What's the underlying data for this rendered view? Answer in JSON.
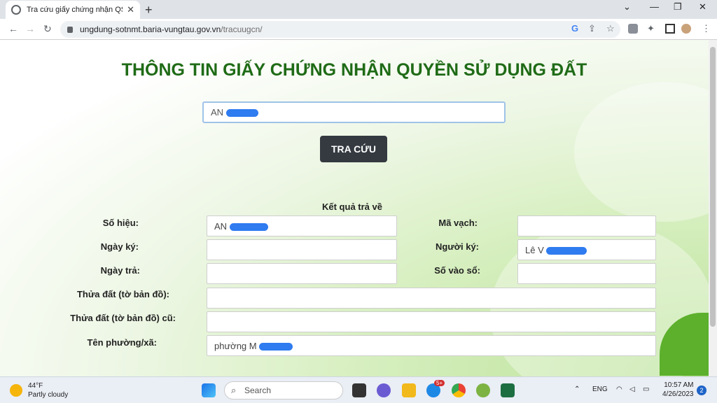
{
  "browser": {
    "tab_title": "Tra cứu giấy chứng nhận QSDĐ",
    "tab_close": "✕",
    "new_tab": "+",
    "url_host": "ungdung-sotnmt.baria-vungtau.gov.vn",
    "url_path": "/tracuugcn/",
    "window_minimize": "—",
    "window_restore": "❐",
    "window_close": "✕"
  },
  "page": {
    "title": "THÔNG TIN GIẤY CHỨNG NHẬN QUYỀN SỬ DỤNG ĐẤT",
    "search_value": "AN",
    "search_button": "TRA CỨU",
    "result_title": "Kết quả trả về",
    "fields": {
      "so_hieu_label": "Số hiệu:",
      "so_hieu_value": "AN",
      "ngay_ky_label": "Ngày ký:",
      "ngay_ky_value": "",
      "ngay_tra_label": "Ngày trả:",
      "ngay_tra_value": "",
      "ma_vach_label": "Mã vạch:",
      "ma_vach_value": "",
      "nguoi_ky_label": "Người ký:",
      "nguoi_ky_value": "Lê V",
      "so_vao_so_label": "Số vào sổ:",
      "so_vao_so_value": "",
      "thua_dat_label": "Thửa đất (tờ bản đồ):",
      "thua_dat_value": "",
      "thua_dat_cu_label": "Thửa đất (tờ bản đồ) cũ:",
      "thua_dat_cu_value": "",
      "ten_phuong_label": "Tên phường/xã:",
      "ten_phuong_value": "phường M"
    }
  },
  "taskbar": {
    "temperature": "44°F",
    "weather": "Partly cloudy",
    "search_label": "Search",
    "language": "ENG",
    "time": "10:57 AM",
    "date": "4/26/2023",
    "notification_count": "2",
    "chat_badge": "5+"
  },
  "colors": {
    "title_green": "#1f6b17",
    "button_dark": "#343a40",
    "redaction_blue": "#2f7bf0"
  }
}
